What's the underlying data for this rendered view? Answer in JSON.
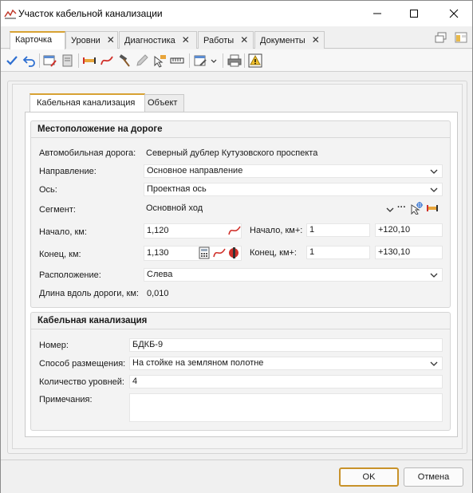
{
  "window": {
    "title": "Участок кабельной канализации"
  },
  "tabs": [
    {
      "label": "Карточка",
      "closable": false,
      "active": true
    },
    {
      "label": "Уровни",
      "closable": true
    },
    {
      "label": "Диагностика",
      "closable": true
    },
    {
      "label": "Работы",
      "closable": true
    },
    {
      "label": "Документы",
      "closable": true
    }
  ],
  "tab_close_glyph": "✕",
  "inner_tabs": [
    {
      "label": "Кабельная канализация",
      "active": true
    },
    {
      "label": "Объект"
    }
  ],
  "location": {
    "title": "Местоположение на дороге",
    "road_label": "Автомобильная дорога:",
    "road_value": "Северный дублер Кутузовского проспекта",
    "direction_label": "Направление:",
    "direction_value": "Основное направление",
    "axis_label": "Ось:",
    "axis_value": "Проектная ось",
    "segment_label": "Сегмент:",
    "segment_value": "Основной ход",
    "segment_more": "···",
    "start_label": "Начало, км:",
    "start_value": "1,120",
    "start_kmplus_label": "Начало, км+:",
    "start_km": "1",
    "start_plus": "+120,10",
    "end_label": "Конец, км:",
    "end_value": "1,130",
    "end_kmplus_label": "Конец, км+:",
    "end_km": "1",
    "end_plus": "+130,10",
    "position_label": "Расположение:",
    "position_value": "Слева",
    "length_label": "Длина вдоль дороги, км:",
    "length_value": "0,010"
  },
  "cable": {
    "title": "Кабельная канализация",
    "number_label": "Номер:",
    "number_value": "БДКБ-9",
    "placement_label": "Способ размещения:",
    "placement_value": "На стойке на земляном полотне",
    "levels_label": "Количество уровней:",
    "levels_value": "4",
    "notes_label": "Примечания:",
    "notes_value": ""
  },
  "footer": {
    "ok_label": "OK",
    "cancel_label": "Отмена"
  },
  "colors": {
    "accent": "#d7a233",
    "check": "#2e6fd1",
    "red": "#d0302a"
  }
}
